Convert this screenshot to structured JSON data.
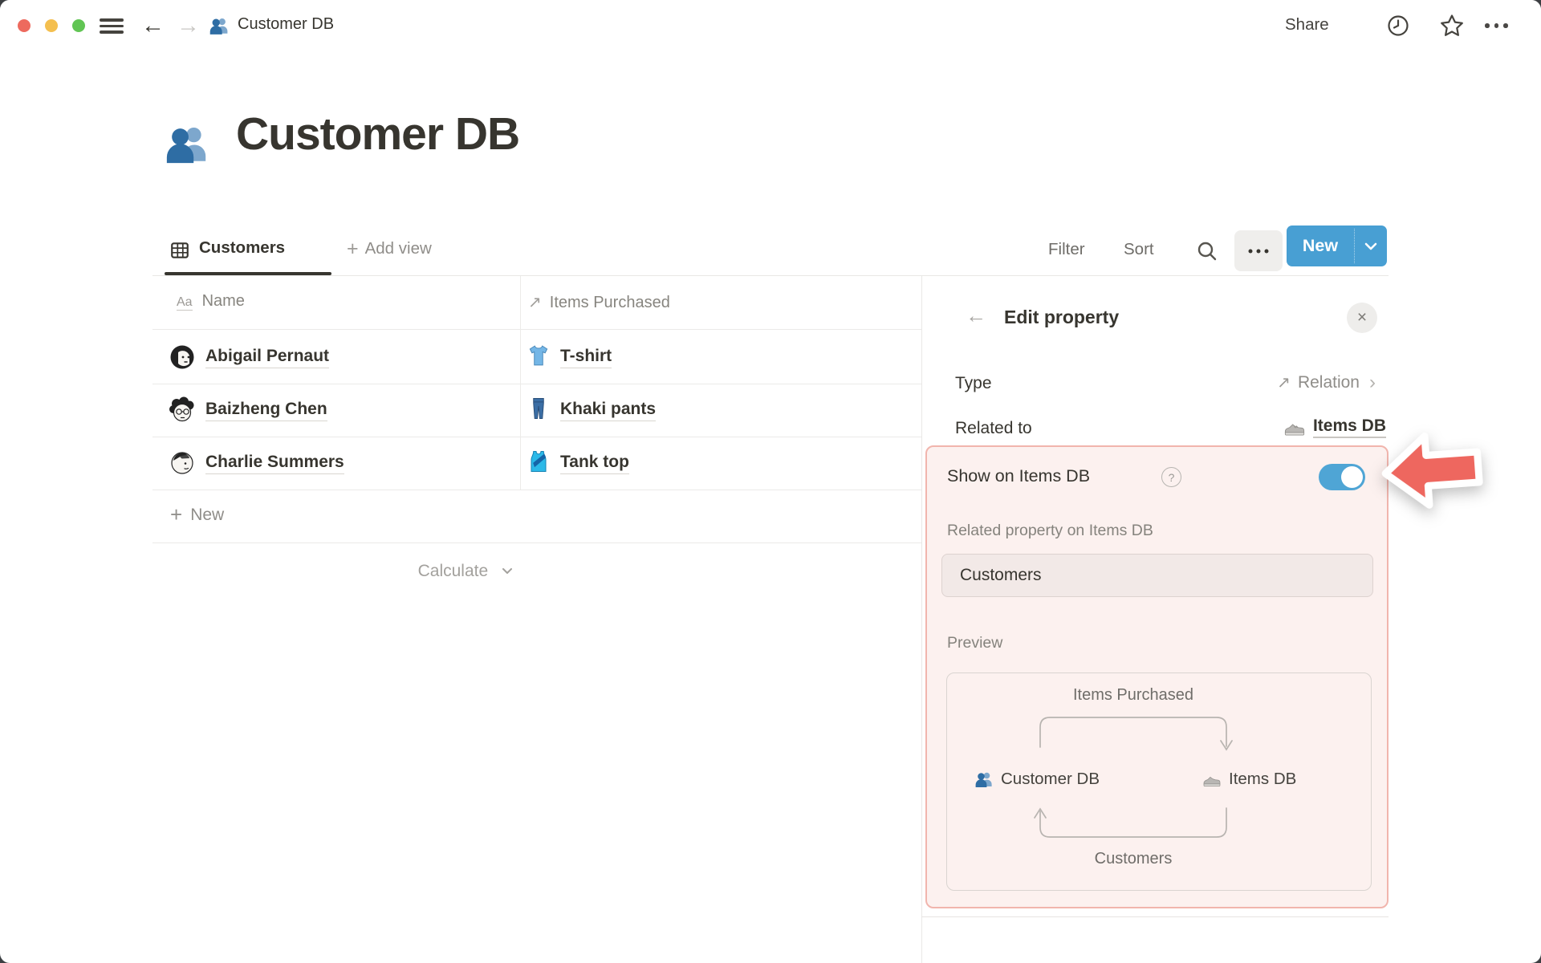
{
  "window": {
    "traffic_lights": {
      "close": "#ed6a5e",
      "minimize": "#f4bf4f",
      "zoom": "#61c554"
    },
    "breadcrumb": {
      "icon": "people-icon",
      "label": "Customer DB"
    },
    "actions": {
      "share": "Share",
      "icons": [
        "clock-icon",
        "star-icon",
        "more-icon"
      ]
    }
  },
  "page": {
    "icon": "people-icon",
    "title": "Customer DB"
  },
  "toolbar": {
    "active_view": {
      "icon": "table-view-icon",
      "label": "Customers"
    },
    "add_view": "Add view",
    "filter": "Filter",
    "sort": "Sort",
    "new_label": "New"
  },
  "table": {
    "columns": [
      {
        "icon": "title-property-icon",
        "icon_glyph": "Aa",
        "label": "Name"
      },
      {
        "icon": "relation-icon",
        "icon_glyph": "↗",
        "label": "Items Purchased"
      }
    ],
    "rows": [
      {
        "avatar": "avatar-woman-bob-icon",
        "name": "Abigail Pernaut",
        "item_icon": "tshirt-icon",
        "item": "T-shirt"
      },
      {
        "avatar": "avatar-man-curly-glasses-icon",
        "name": "Baizheng Chen",
        "item_icon": "jeans-icon",
        "item": "Khaki pants"
      },
      {
        "avatar": "avatar-person-sunglasses-icon",
        "name": "Charlie Summers",
        "item_icon": "tank-top-icon",
        "item": "Tank top"
      }
    ],
    "new_row": "New",
    "calculate": "Calculate"
  },
  "panel": {
    "title": "Edit property",
    "close_glyph": "×",
    "back_glyph": "←",
    "fields": {
      "type": {
        "label": "Type",
        "value": "Relation",
        "value_icon_glyph": "↗",
        "chevron": "›"
      },
      "related_to": {
        "label": "Related to",
        "value": "Items DB",
        "value_icon": "sneaker-icon"
      }
    },
    "highlight": {
      "toggle_label": "Show on Items DB",
      "help_glyph": "?",
      "toggle_on": true,
      "related_property_label": "Related property on Items DB",
      "input_value": "Customers",
      "preview_label": "Preview",
      "diagram": {
        "top_label": "Items Purchased",
        "left_node": {
          "icon": "people-icon",
          "label": "Customer DB"
        },
        "right_node": {
          "icon": "sneaker-icon",
          "label": "Items DB"
        },
        "bottom_label": "Customers"
      }
    }
  },
  "nav": {
    "back_glyph": "←",
    "forward_glyph": "→"
  },
  "colors": {
    "accent_blue": "#489fd3",
    "toggle_blue": "#4fa5d5",
    "highlight_bg": "#fcf1ef",
    "highlight_border": "#f1b5ad",
    "annotation_red": "#ee675f",
    "text_dark": "#37352f",
    "text_gray": "#8f8d89"
  }
}
